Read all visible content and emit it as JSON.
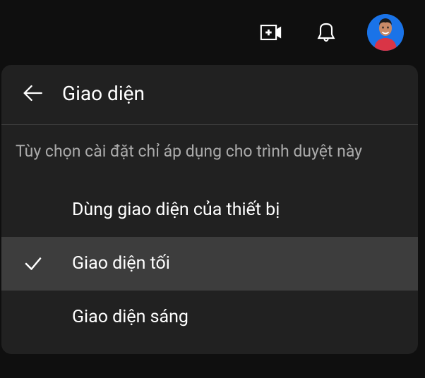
{
  "panel": {
    "title": "Giao diện",
    "description": "Tùy chọn cài đặt chỉ áp dụng cho trình duyệt này"
  },
  "options": [
    {
      "label": "Dùng giao diện của thiết bị",
      "selected": false
    },
    {
      "label": "Giao diện tối",
      "selected": true
    },
    {
      "label": "Giao diện sáng",
      "selected": false
    }
  ]
}
